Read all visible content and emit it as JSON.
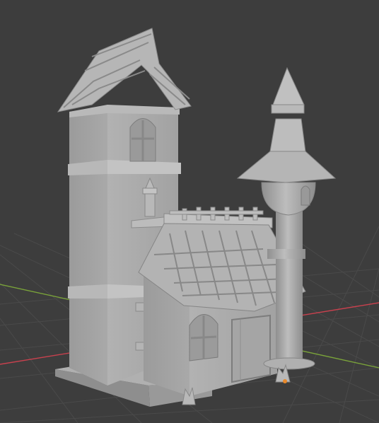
{
  "viewport": {
    "background_color": "#3d3d3d",
    "grid_color": "#4a4a4a",
    "x_axis_color": "#c8414e",
    "y_axis_color": "#7aa33a",
    "object_origin_color": "#e8892b"
  },
  "scene": {
    "object_material_color": "#a7a7a7",
    "object_shadow_color": "#868686",
    "object_highlight_color": "#bdbdbd"
  }
}
